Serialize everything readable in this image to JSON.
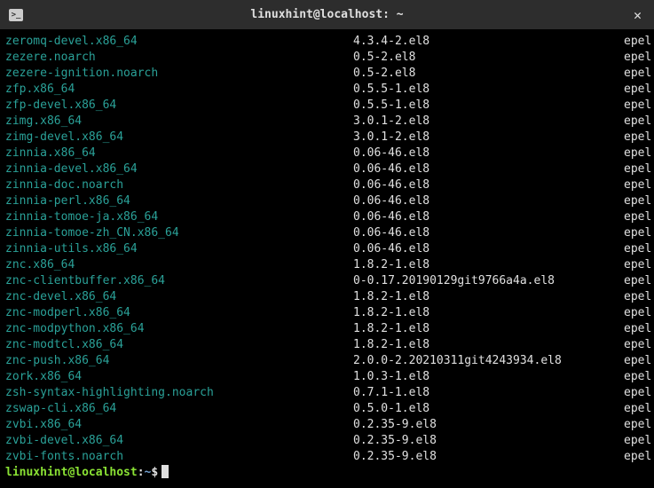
{
  "window": {
    "title": "linuxhint@localhost: ~",
    "terminal_icon": ">_"
  },
  "packages": [
    {
      "name": "zeromq-devel.x86_64",
      "version": "4.3.4-2.el8",
      "repo": "epel"
    },
    {
      "name": "zezere.noarch",
      "version": "0.5-2.el8",
      "repo": "epel"
    },
    {
      "name": "zezere-ignition.noarch",
      "version": "0.5-2.el8",
      "repo": "epel"
    },
    {
      "name": "zfp.x86_64",
      "version": "0.5.5-1.el8",
      "repo": "epel"
    },
    {
      "name": "zfp-devel.x86_64",
      "version": "0.5.5-1.el8",
      "repo": "epel"
    },
    {
      "name": "zimg.x86_64",
      "version": "3.0.1-2.el8",
      "repo": "epel"
    },
    {
      "name": "zimg-devel.x86_64",
      "version": "3.0.1-2.el8",
      "repo": "epel"
    },
    {
      "name": "zinnia.x86_64",
      "version": "0.06-46.el8",
      "repo": "epel"
    },
    {
      "name": "zinnia-devel.x86_64",
      "version": "0.06-46.el8",
      "repo": "epel"
    },
    {
      "name": "zinnia-doc.noarch",
      "version": "0.06-46.el8",
      "repo": "epel"
    },
    {
      "name": "zinnia-perl.x86_64",
      "version": "0.06-46.el8",
      "repo": "epel"
    },
    {
      "name": "zinnia-tomoe-ja.x86_64",
      "version": "0.06-46.el8",
      "repo": "epel"
    },
    {
      "name": "zinnia-tomoe-zh_CN.x86_64",
      "version": "0.06-46.el8",
      "repo": "epel"
    },
    {
      "name": "zinnia-utils.x86_64",
      "version": "0.06-46.el8",
      "repo": "epel"
    },
    {
      "name": "znc.x86_64",
      "version": "1.8.2-1.el8",
      "repo": "epel"
    },
    {
      "name": "znc-clientbuffer.x86_64",
      "version": "0-0.17.20190129git9766a4a.el8",
      "repo": "epel"
    },
    {
      "name": "znc-devel.x86_64",
      "version": "1.8.2-1.el8",
      "repo": "epel"
    },
    {
      "name": "znc-modperl.x86_64",
      "version": "1.8.2-1.el8",
      "repo": "epel"
    },
    {
      "name": "znc-modpython.x86_64",
      "version": "1.8.2-1.el8",
      "repo": "epel"
    },
    {
      "name": "znc-modtcl.x86_64",
      "version": "1.8.2-1.el8",
      "repo": "epel"
    },
    {
      "name": "znc-push.x86_64",
      "version": "2.0.0-2.20210311git4243934.el8",
      "repo": "epel"
    },
    {
      "name": "zork.x86_64",
      "version": "1.0.3-1.el8",
      "repo": "epel"
    },
    {
      "name": "zsh-syntax-highlighting.noarch",
      "version": "0.7.1-1.el8",
      "repo": "epel"
    },
    {
      "name": "zswap-cli.x86_64",
      "version": "0.5.0-1.el8",
      "repo": "epel"
    },
    {
      "name": "zvbi.x86_64",
      "version": "0.2.35-9.el8",
      "repo": "epel"
    },
    {
      "name": "zvbi-devel.x86_64",
      "version": "0.2.35-9.el8",
      "repo": "epel"
    },
    {
      "name": "zvbi-fonts.noarch",
      "version": "0.2.35-9.el8",
      "repo": "epel"
    }
  ],
  "prompt": {
    "user_host": "linuxhint@localhost",
    "colon": ":",
    "path": "~",
    "dollar": "$"
  }
}
